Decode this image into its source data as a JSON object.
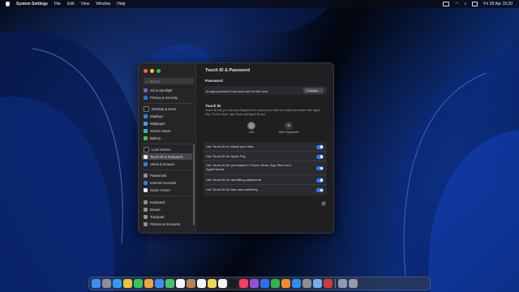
{
  "menubar": {
    "app_name": "System Settings",
    "menus": [
      "File",
      "Edit",
      "View",
      "Window",
      "Help"
    ],
    "clock": "Fri 28 Apr 15:20"
  },
  "sidebar": {
    "search_placeholder": "Search",
    "items": [
      {
        "label": "Siri & Spotlight",
        "icon": "siri-icon",
        "color": "#8f4fd8"
      },
      {
        "label": "Privacy & Security",
        "icon": "hand-icon",
        "color": "#2f6fdc"
      },
      {
        "label": "Desktop & Dock",
        "icon": "dock-icon",
        "color": "#1c1c1e"
      },
      {
        "label": "Displays",
        "icon": "display-icon",
        "color": "#2f7bf5"
      },
      {
        "label": "Wallpaper",
        "icon": "wallpaper-icon",
        "color": "#39a7e8"
      },
      {
        "label": "Screen Saver",
        "icon": "screensaver-icon",
        "color": "#31b6c7"
      },
      {
        "label": "Battery",
        "icon": "battery-icon",
        "color": "#34c759"
      },
      {
        "label": "Lock Screen",
        "icon": "lock-icon",
        "color": "#1c1c1e"
      },
      {
        "label": "Touch ID & Password",
        "icon": "fingerprint-icon",
        "color": "#e8e8ea"
      },
      {
        "label": "Users & Groups",
        "icon": "users-icon",
        "color": "#2f7bf5"
      },
      {
        "label": "Passwords",
        "icon": "key-icon",
        "color": "#8e8e93"
      },
      {
        "label": "Internet Accounts",
        "icon": "at-icon",
        "color": "#2f7bf5"
      },
      {
        "label": "Game Center",
        "icon": "gamecenter-icon",
        "color": "#e8e8ea"
      },
      {
        "label": "Keyboard",
        "icon": "keyboard-icon",
        "color": "#8e8e93"
      },
      {
        "label": "Mouse",
        "icon": "mouse-icon",
        "color": "#8e8e93"
      },
      {
        "label": "Trackpad",
        "icon": "trackpad-icon",
        "color": "#8e8e93"
      },
      {
        "label": "Printers & Scanners",
        "icon": "printer-icon",
        "color": "#8e8e93"
      }
    ]
  },
  "main": {
    "title": "Touch ID & Password",
    "password_section": "Password",
    "password_text": "A login password has been set for this user",
    "change_button": "Change...",
    "touchid_section": "Touch ID",
    "touchid_desc": "Touch ID lets you use your fingerprint to unlock your Mac and make purchases with Apple Pay, iTunes Store, App Store and Apple Books.",
    "fingerprint_label": "Left",
    "add_fingerprint_label": "Add Fingerprint",
    "toggles": [
      {
        "label": "Use Touch ID to unlock your Mac",
        "on": true
      },
      {
        "label": "Use Touch ID for Apple Pay",
        "on": true
      },
      {
        "label": "Use Touch ID for purchases in iTunes Store, App Store and Apple Books",
        "on": true
      },
      {
        "label": "Use Touch ID for autofilling passwords",
        "on": true
      },
      {
        "label": "Use Touch ID for fast user switching",
        "on": true
      }
    ],
    "help_label": "?"
  },
  "colors": {
    "accent": "#2f7bf5",
    "window_bg": "#1f1f22",
    "sidebar_bg": "#252528"
  },
  "dock": {
    "apps": [
      "finder-icon",
      "launchpad-icon",
      "safari-icon",
      "chrome-icon",
      "messages-icon",
      "photos-icon",
      "mail-icon",
      "maps-icon",
      "calendar-icon",
      "contacts-icon",
      "reminders-icon",
      "notes-icon",
      "freeform-icon",
      "tv-icon",
      "music-icon",
      "podcasts-icon",
      "keynote-icon",
      "numbers-icon",
      "pages-icon",
      "appstore-icon",
      "settings-icon",
      "preview-icon",
      "photobooth-icon",
      "downloads-icon",
      "trash-icon"
    ]
  }
}
